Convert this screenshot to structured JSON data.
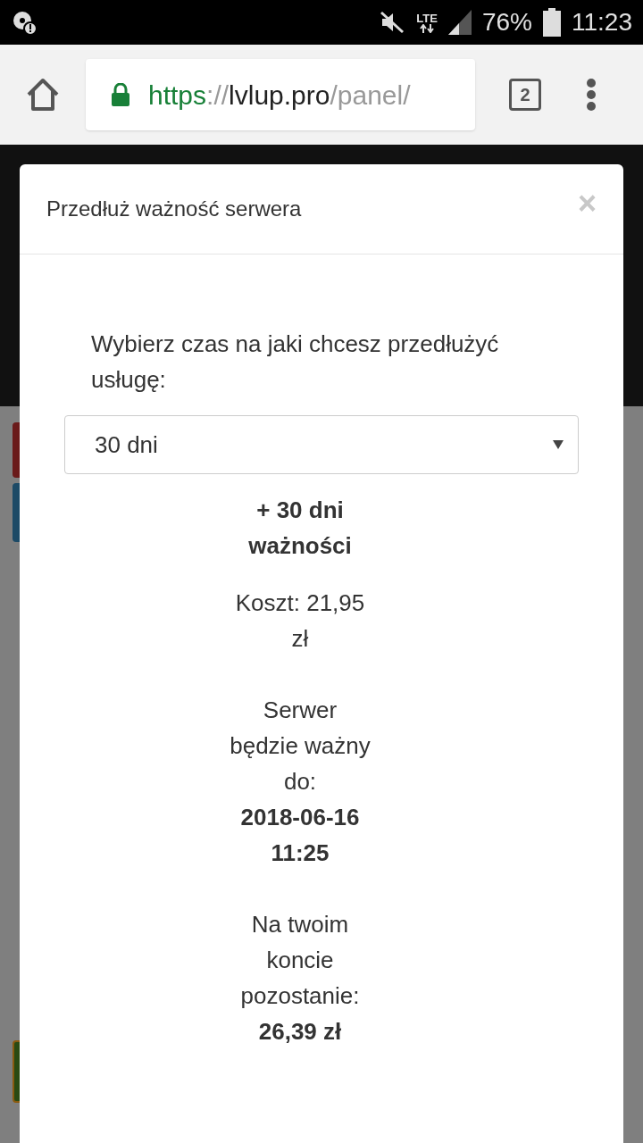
{
  "status_bar": {
    "network": "LTE",
    "battery": "76%",
    "time": "11:23"
  },
  "browser": {
    "url_scheme": "https",
    "url_separator": "://",
    "url_host": "lvlup.pro",
    "url_path": "/panel/",
    "tab_count": "2"
  },
  "modal": {
    "title": "Przedłuż ważność serwera",
    "close": "×",
    "prompt": "Wybierz czas na jaki chcesz przedłużyć usługę:",
    "select": {
      "value": "30 dni"
    },
    "summary": [
      {
        "text": "+ 30 dni ważności",
        "bold": true
      },
      {
        "text": "Koszt: 21,95 zł",
        "bold": false
      }
    ],
    "valid_until": {
      "label": "Serwer będzie ważny do:",
      "value": "2018-06-16 11:25"
    },
    "remaining": {
      "label": "Na twoim koncie pozostanie:",
      "value": "26,39 zł"
    }
  }
}
